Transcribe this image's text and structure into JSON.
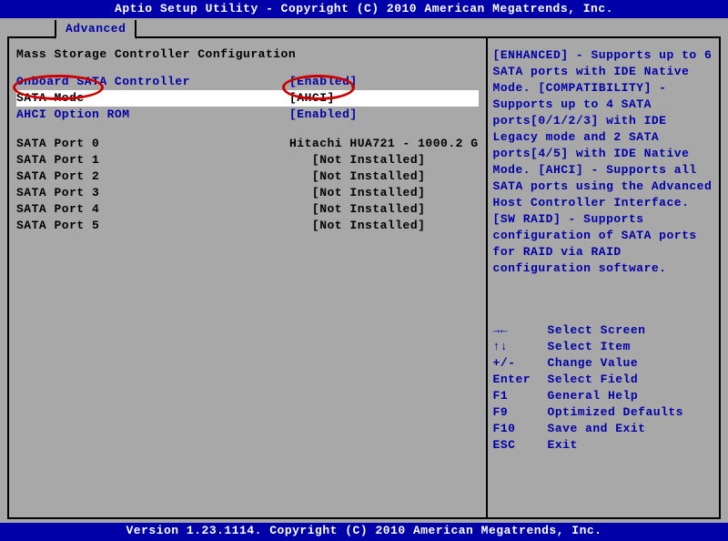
{
  "header": "Aptio Setup Utility - Copyright (C) 2010 American Megatrends, Inc.",
  "tab": "Advanced",
  "section_title": "Mass Storage Controller Configuration",
  "settings": {
    "onboard": {
      "label": "Onboard SATA Controller",
      "value": "[Enabled]"
    },
    "satamode": {
      "label": "SATA Mode",
      "value": "[AHCI]"
    },
    "ahcirom": {
      "label": "AHCI Option ROM",
      "value": "[Enabled]"
    }
  },
  "ports": [
    {
      "label": "SATA Port 0",
      "value": "Hitachi HUA721 - 1000.2 G"
    },
    {
      "label": "SATA Port 1",
      "value": "   [Not Installed]"
    },
    {
      "label": "SATA Port 2",
      "value": "   [Not Installed]"
    },
    {
      "label": "SATA Port 3",
      "value": "   [Not Installed]"
    },
    {
      "label": "SATA Port 4",
      "value": "   [Not Installed]"
    },
    {
      "label": "SATA Port 5",
      "value": "   [Not Installed]"
    }
  ],
  "help": "[ENHANCED] - Supports up to 6 SATA ports with IDE Native Mode. [COMPATIBILITY] - Supports up to 4 SATA ports[0/1/2/3] with IDE Legacy mode and 2 SATA ports[4/5] with IDE Native Mode. [AHCI] - Supports all SATA ports using the Advanced Host Controller Interface. [SW RAID] - Supports configuration of SATA ports for RAID via RAID configuration software.",
  "keys": [
    {
      "k": "→←",
      "d": "Select Screen"
    },
    {
      "k": "↑↓",
      "d": "Select Item"
    },
    {
      "k": "+/-",
      "d": "Change Value"
    },
    {
      "k": "Enter",
      "d": "Select Field"
    },
    {
      "k": "F1",
      "d": "General Help"
    },
    {
      "k": "F9",
      "d": "Optimized Defaults"
    },
    {
      "k": "F10",
      "d": "Save and Exit"
    },
    {
      "k": "ESC",
      "d": "Exit"
    }
  ],
  "footer": "Version 1.23.1114. Copyright (C) 2010 American Megatrends, Inc."
}
